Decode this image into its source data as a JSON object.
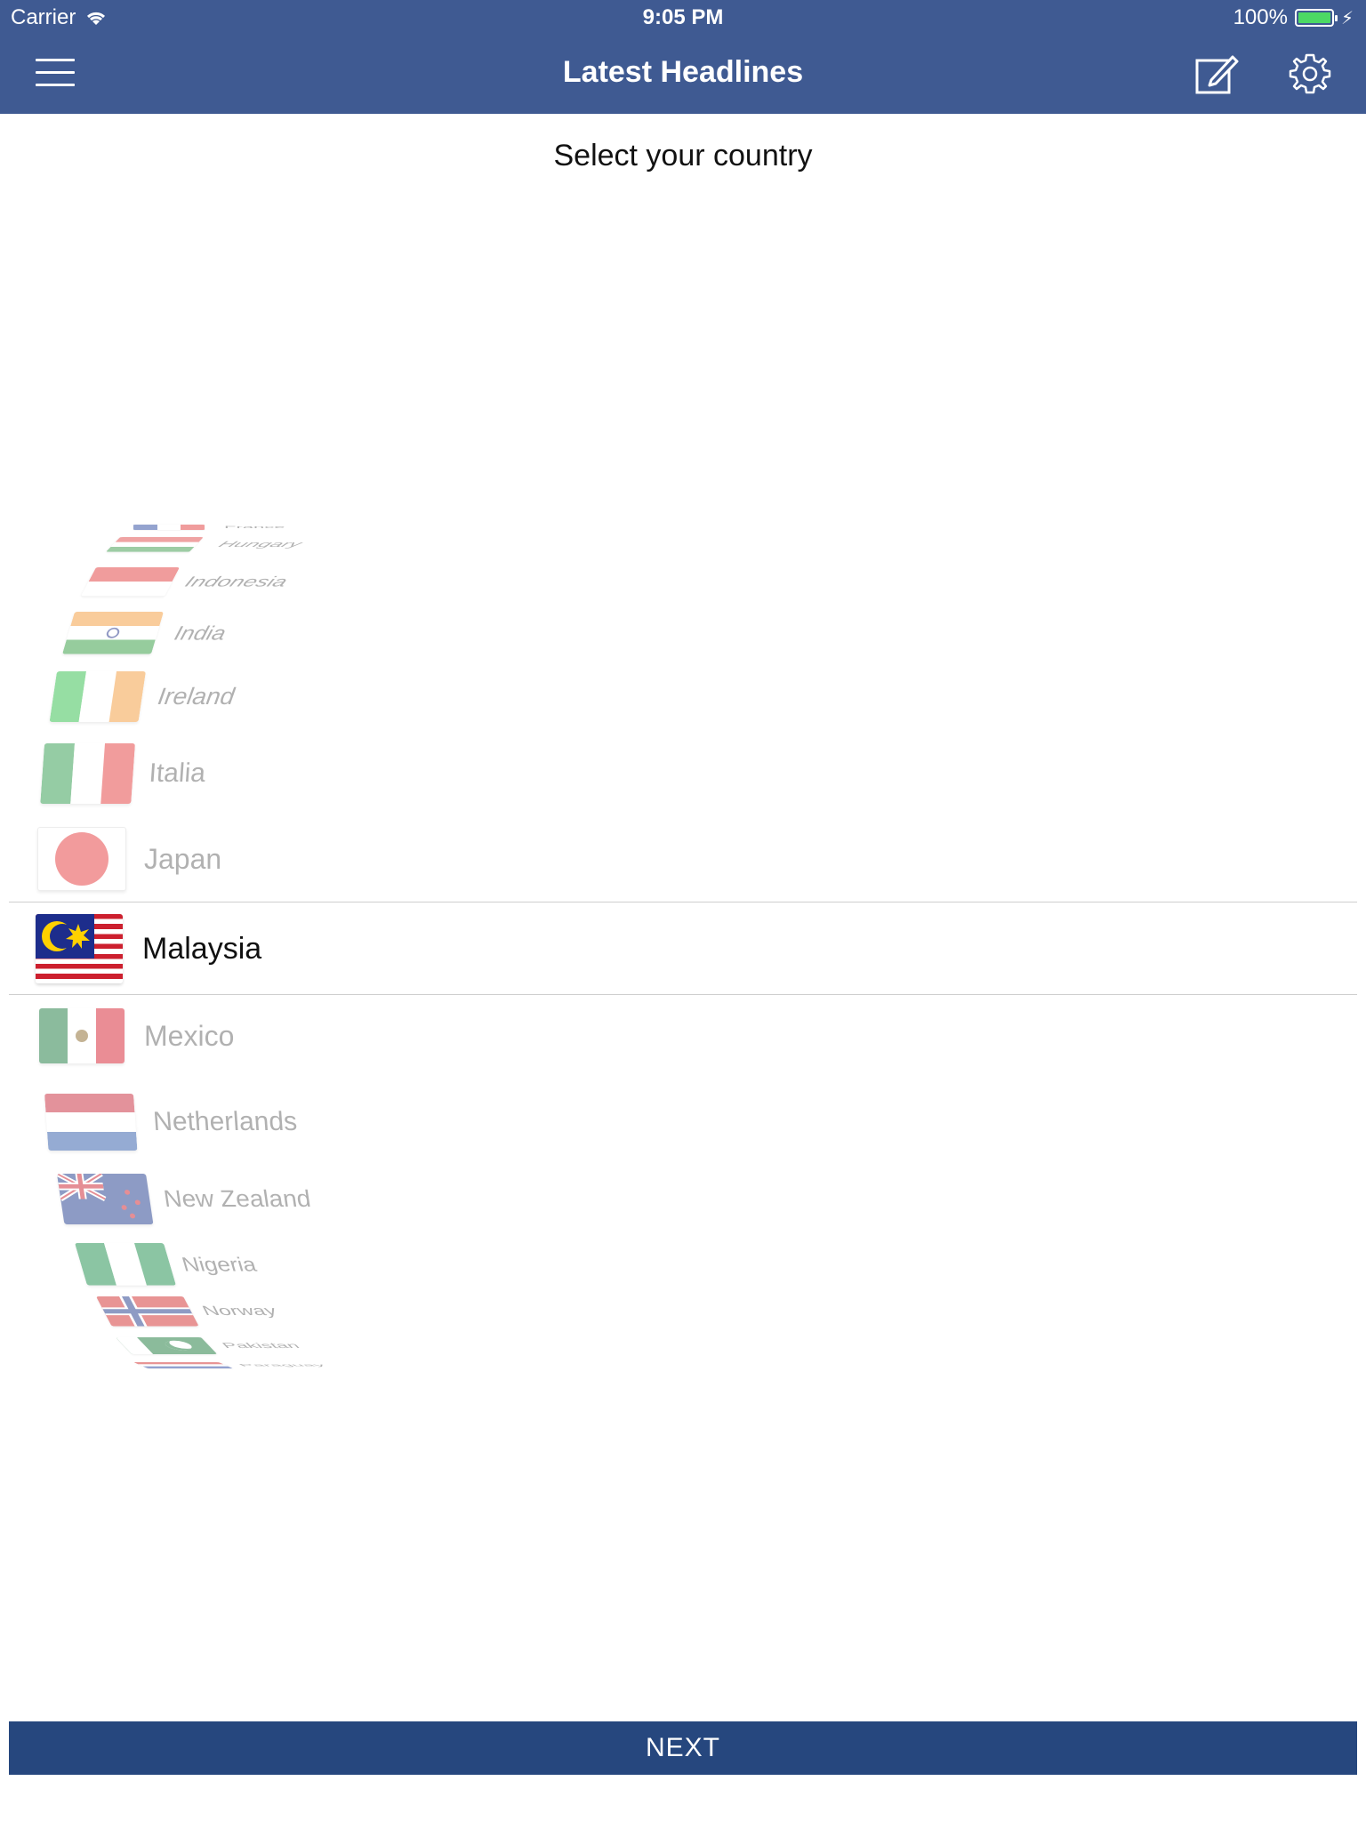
{
  "status_bar": {
    "carrier": "Carrier",
    "time": "9:05 PM",
    "battery": "100%"
  },
  "nav": {
    "title": "Latest Headlines",
    "menu_icon": "hamburger-menu-icon",
    "compose_icon": "compose-icon",
    "settings_icon": "gear-icon"
  },
  "subtitle": "Select your country",
  "picker": {
    "items": [
      {
        "label": "France"
      },
      {
        "label": "Hungary"
      },
      {
        "label": "Indonesia"
      },
      {
        "label": "India"
      },
      {
        "label": "Ireland"
      },
      {
        "label": "Italia"
      },
      {
        "label": "Japan"
      },
      {
        "label": "Malaysia"
      },
      {
        "label": "Mexico"
      },
      {
        "label": "Netherlands"
      },
      {
        "label": "New Zealand"
      },
      {
        "label": "Nigeria"
      },
      {
        "label": "Norway"
      },
      {
        "label": "Pakistan"
      },
      {
        "label": "Paraguay"
      }
    ],
    "selected": "Malaysia"
  },
  "next_label": "NEXT",
  "colors": {
    "nav_bg": "#3f5a92",
    "button_bg": "#26477e",
    "battery_green": "#4cd964"
  }
}
